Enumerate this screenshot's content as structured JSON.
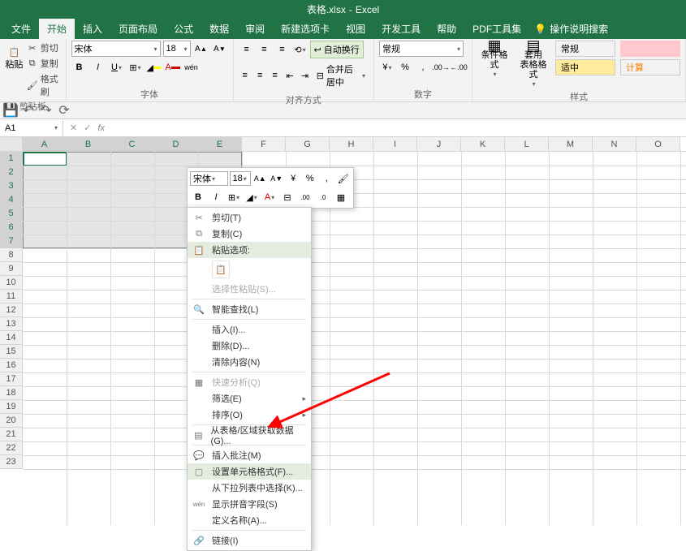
{
  "title": {
    "filename": "表格.xlsx",
    "app": "Excel"
  },
  "tabs": [
    "文件",
    "开始",
    "插入",
    "页面布局",
    "公式",
    "数据",
    "审阅",
    "新建选项卡",
    "视图",
    "开发工具",
    "帮助",
    "PDF工具集"
  ],
  "tellme": "操作说明搜索",
  "active_tab": "开始",
  "clipboard": {
    "cut": "剪切",
    "copy": "复制",
    "painter": "格式刷",
    "paste": "粘贴",
    "label": "剪贴板"
  },
  "font": {
    "name": "宋体",
    "size": "18",
    "label": "字体"
  },
  "align": {
    "wrap": "自动换行",
    "merge": "合并后居中",
    "label": "对齐方式"
  },
  "number": {
    "format": "常规",
    "label": "数字"
  },
  "styles": {
    "cond": "条件格式",
    "table": "套用\n表格格式",
    "normal": "常规",
    "good": "适中",
    "calc": "计算",
    "label": "样式"
  },
  "namebox": "A1",
  "columns": [
    "A",
    "B",
    "C",
    "D",
    "E",
    "F",
    "G",
    "H",
    "I",
    "J",
    "K",
    "L",
    "M",
    "N",
    "O"
  ],
  "rows_count": 23,
  "selected_cols": 5,
  "selected_rows": 7,
  "mini_toolbar": {
    "font": "宋体",
    "size": "18"
  },
  "context_menu": {
    "cut": "剪切(T)",
    "copy": "复制(C)",
    "paste_options": "粘贴选项:",
    "paste_special": "选择性粘贴(S)...",
    "smart_lookup": "智能查找(L)",
    "insert": "插入(I)...",
    "delete": "删除(D)...",
    "clear": "清除内容(N)",
    "quick_analysis": "快速分析(Q)",
    "filter": "筛选(E)",
    "sort": "排序(O)",
    "get_from_table": "从表格/区域获取数据(G)...",
    "insert_comment": "插入批注(M)",
    "format_cells": "设置单元格格式(F)...",
    "pick_from_list": "从下拉列表中选择(K)...",
    "show_phonetic": "显示拼音字段(S)",
    "define_name": "定义名称(A)...",
    "link": "链接(I)"
  }
}
